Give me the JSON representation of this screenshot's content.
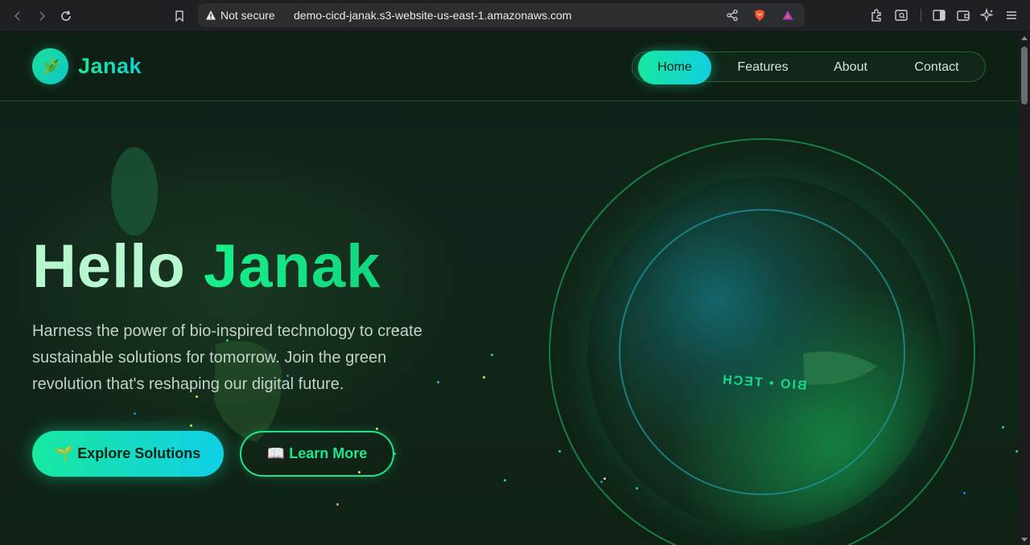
{
  "browser": {
    "security_label": "Not secure",
    "url": "demo-cicd-janak.s3-website-us-east-1.amazonaws.com"
  },
  "brand": {
    "name": "Janak",
    "logo_icon": "leaf-branch-icon"
  },
  "nav": {
    "items": [
      {
        "label": "Home",
        "active": true
      },
      {
        "label": "Features",
        "active": false
      },
      {
        "label": "About",
        "active": false
      },
      {
        "label": "Contact",
        "active": false
      }
    ]
  },
  "hero": {
    "title_word1": "Hello",
    "title_word2": "Janak",
    "description": "Harness the power of bio-inspired technology to create sustainable solutions for tomorrow. Join the green revolution that's reshaping our digital future.",
    "primary_button": "🌱 Explore Solutions",
    "secondary_button": "📖 Learn More"
  },
  "orb": {
    "label": "BIO • TECH"
  },
  "colors": {
    "accent_green": "#17e8a0",
    "accent_cyan": "#10cfe6",
    "background": "#0f2116"
  }
}
